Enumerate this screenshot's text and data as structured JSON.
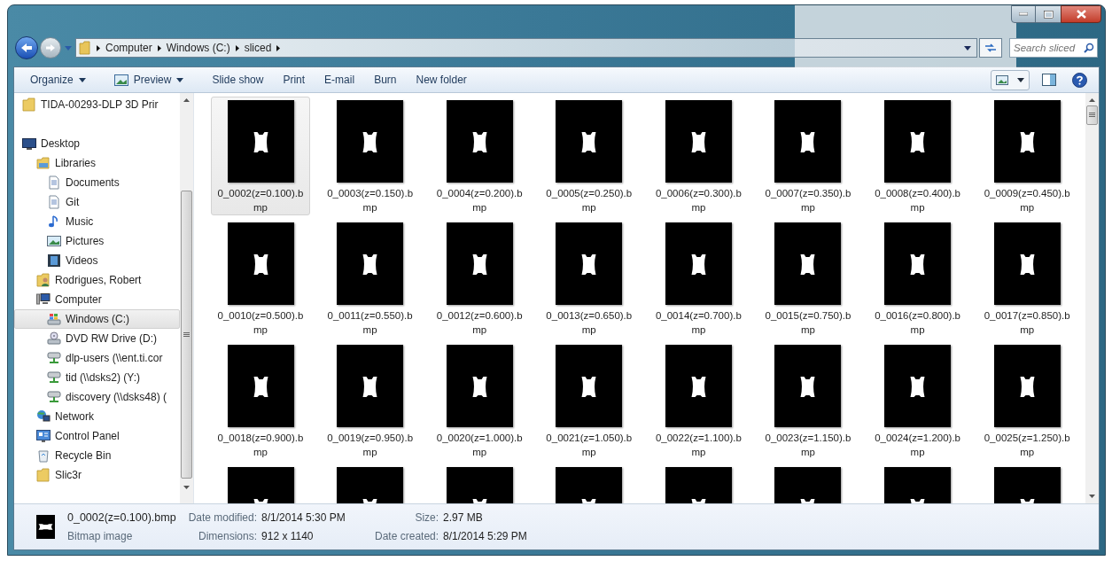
{
  "address": {
    "crumbs": [
      "Computer",
      "Windows (C:)",
      "sliced"
    ]
  },
  "search": {
    "placeholder": "Search sliced"
  },
  "toolbar": {
    "items": [
      {
        "label": "Organize",
        "dropdown": true,
        "kind": "menu"
      },
      {
        "label": "Preview",
        "dropdown": true,
        "kind": "preview"
      },
      {
        "label": "Slide show",
        "dropdown": false,
        "kind": "plain"
      },
      {
        "label": "Print",
        "dropdown": false,
        "kind": "plain"
      },
      {
        "label": "E-mail",
        "dropdown": false,
        "kind": "plain"
      },
      {
        "label": "Burn",
        "dropdown": false,
        "kind": "plain"
      },
      {
        "label": "New folder",
        "dropdown": false,
        "kind": "plain"
      }
    ]
  },
  "sidebar": {
    "items": [
      {
        "label": "TIDA-00293-DLP 3D Prir",
        "kind": "folder",
        "selected": false
      },
      {
        "label": "Desktop",
        "kind": "desktop",
        "selected": false,
        "children": [
          {
            "label": "Libraries",
            "kind": "library",
            "selected": false,
            "children": [
              {
                "label": "Documents",
                "kind": "document",
                "selected": false
              },
              {
                "label": "Git",
                "kind": "document",
                "selected": false
              },
              {
                "label": "Music",
                "kind": "music",
                "selected": false
              },
              {
                "label": "Pictures",
                "kind": "pictures",
                "selected": false
              },
              {
                "label": "Videos",
                "kind": "videos",
                "selected": false
              }
            ]
          },
          {
            "label": "Rodrigues, Robert",
            "kind": "user",
            "selected": false
          },
          {
            "label": "Computer",
            "kind": "computer",
            "selected": false,
            "children": [
              {
                "label": "Windows (C:)",
                "kind": "drive",
                "selected": true
              },
              {
                "label": "DVD RW Drive (D:)",
                "kind": "disc",
                "selected": false
              },
              {
                "label": "dlp-users (\\\\ent.ti.cor",
                "kind": "netdrive",
                "selected": false
              },
              {
                "label": "tid (\\\\dsks2) (Y:)",
                "kind": "netdrive",
                "selected": false
              },
              {
                "label": "discovery (\\\\dsks48) (",
                "kind": "netdrive",
                "selected": false
              }
            ]
          },
          {
            "label": "Network",
            "kind": "network",
            "selected": false
          },
          {
            "label": "Control Panel",
            "kind": "control",
            "selected": false
          },
          {
            "label": "Recycle Bin",
            "kind": "recycle",
            "selected": false
          },
          {
            "label": "Slic3r",
            "kind": "folder",
            "selected": false
          }
        ]
      }
    ]
  },
  "files": [
    {
      "name": "0_0002(z=0.100).bmp",
      "selected": true
    },
    {
      "name": "0_0003(z=0.150).bmp",
      "selected": false
    },
    {
      "name": "0_0004(z=0.200).bmp",
      "selected": false
    },
    {
      "name": "0_0005(z=0.250).bmp",
      "selected": false
    },
    {
      "name": "0_0006(z=0.300).bmp",
      "selected": false
    },
    {
      "name": "0_0007(z=0.350).bmp",
      "selected": false
    },
    {
      "name": "0_0008(z=0.400).bmp",
      "selected": false
    },
    {
      "name": "0_0009(z=0.450).bmp",
      "selected": false
    },
    {
      "name": "0_0010(z=0.500).bmp",
      "selected": false
    },
    {
      "name": "0_0011(z=0.550).bmp",
      "selected": false
    },
    {
      "name": "0_0012(z=0.600).bmp",
      "selected": false
    },
    {
      "name": "0_0013(z=0.650).bmp",
      "selected": false
    },
    {
      "name": "0_0014(z=0.700).bmp",
      "selected": false
    },
    {
      "name": "0_0015(z=0.750).bmp",
      "selected": false
    },
    {
      "name": "0_0016(z=0.800).bmp",
      "selected": false
    },
    {
      "name": "0_0017(z=0.850).bmp",
      "selected": false
    },
    {
      "name": "0_0018(z=0.900).bmp",
      "selected": false
    },
    {
      "name": "0_0019(z=0.950).bmp",
      "selected": false
    },
    {
      "name": "0_0020(z=1.000).bmp",
      "selected": false
    },
    {
      "name": "0_0021(z=1.050).bmp",
      "selected": false
    },
    {
      "name": "0_0022(z=1.100).bmp",
      "selected": false
    },
    {
      "name": "0_0023(z=1.150).bmp",
      "selected": false
    },
    {
      "name": "0_0024(z=1.200).bmp",
      "selected": false
    },
    {
      "name": "0_0025(z=1.250).bmp",
      "selected": false
    },
    {
      "selected": false
    },
    {
      "selected": false
    },
    {
      "selected": false
    },
    {
      "selected": false
    },
    {
      "selected": false
    },
    {
      "selected": false
    },
    {
      "selected": false
    },
    {
      "selected": false
    }
  ],
  "details": {
    "name": "0_0002(z=0.100).bmp",
    "type": "Bitmap image",
    "fields": [
      {
        "label": "Date modified:",
        "value": "8/1/2014 5:30 PM"
      },
      {
        "label": "Size:",
        "value": "2.97 MB"
      },
      {
        "label": "Dimensions:",
        "value": "912 x 1140"
      },
      {
        "label": "Date created:",
        "value": "8/1/2014 5:29 PM"
      }
    ]
  }
}
